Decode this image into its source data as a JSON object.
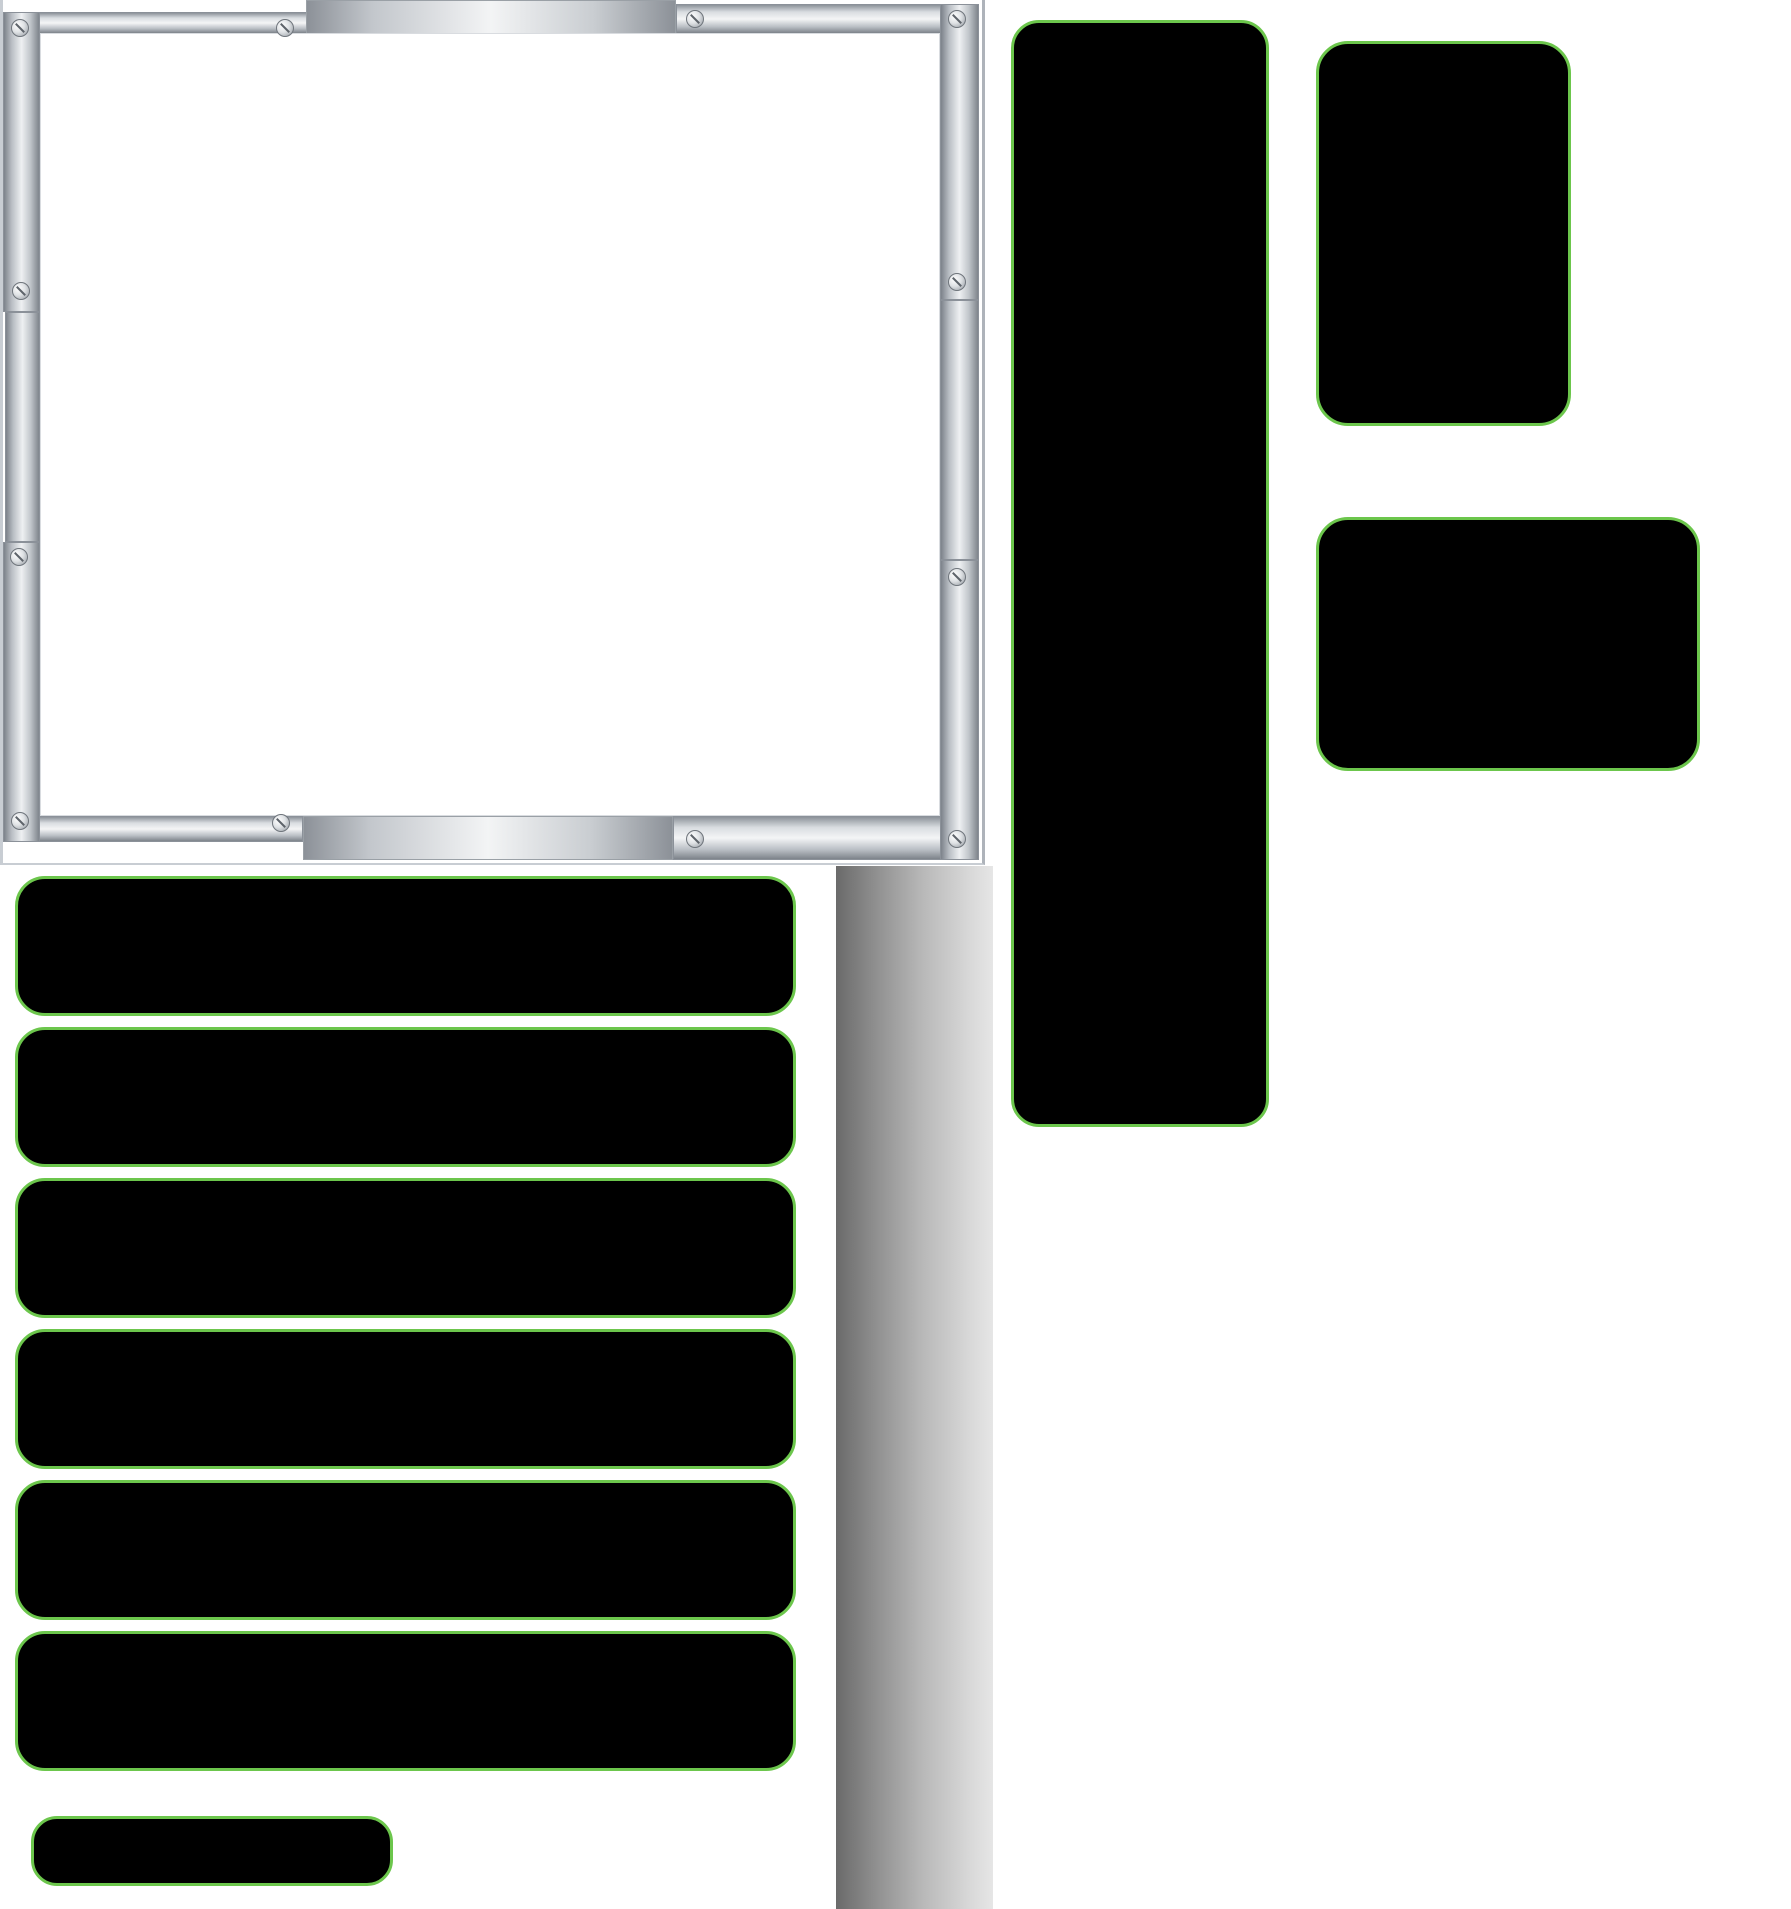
{
  "colors": {
    "background": "#ffffff",
    "panel_fill": "#000000",
    "panel_border": "#6cc64c",
    "metal_light": "#f4f5f6",
    "metal_dark": "#7d838a",
    "grey_bar_dark": "#6a6a6a",
    "grey_bar_light": "#e6e6e6"
  },
  "frame": {
    "style": "brushed-metal",
    "screw_icon": "screw-icon"
  },
  "panels": {
    "list_buttons_count": 6,
    "small_button_count": 1,
    "right_column_count": 3
  }
}
